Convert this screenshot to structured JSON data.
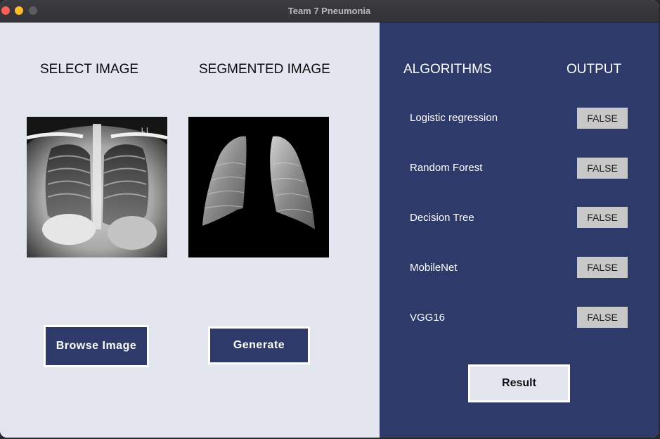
{
  "window": {
    "title": "Team 7 Pneumonia"
  },
  "left": {
    "select_heading": "SELECT IMAGE",
    "segmented_heading": "SEGMENTED IMAGE",
    "browse_label": "Browse Image",
    "generate_label": "Generate",
    "xray_marker": "L ⌊"
  },
  "right": {
    "algorithms_heading": "ALGORITHMS",
    "output_heading": "OUTPUT",
    "rows": [
      {
        "algorithm": "Logistic regression",
        "output": "FALSE"
      },
      {
        "algorithm": "Random Forest",
        "output": "FALSE"
      },
      {
        "algorithm": "Decision Tree",
        "output": "FALSE"
      },
      {
        "algorithm": "MobileNet",
        "output": "FALSE"
      },
      {
        "algorithm": "VGG16",
        "output": "FALSE"
      }
    ],
    "result_label": "Result"
  },
  "colors": {
    "left_bg": "#e3e5ef",
    "right_bg": "#2d3a6a",
    "button_bg": "#2d3a6a",
    "output_box": "#c8c8c8"
  }
}
